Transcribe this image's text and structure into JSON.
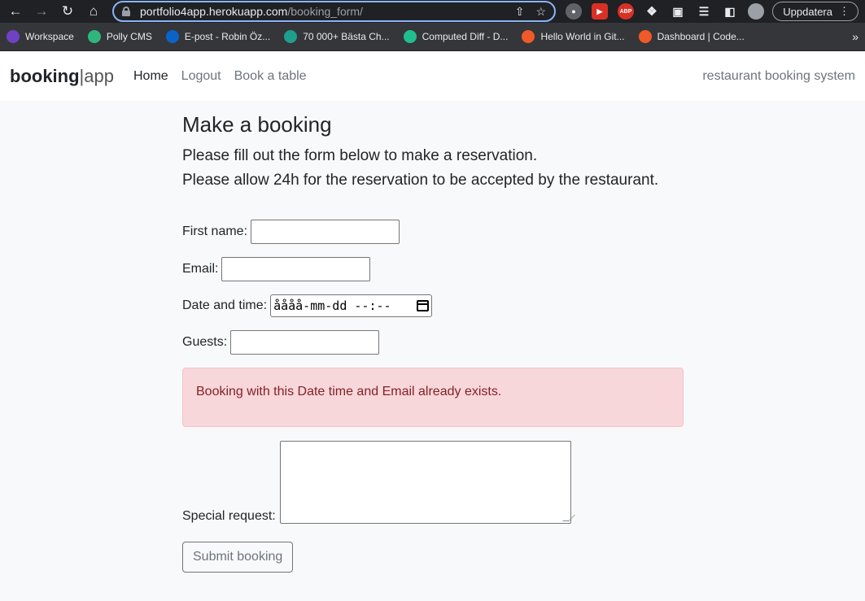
{
  "browser": {
    "url_host": "portfolio4app.herokuapp.com",
    "url_path": "/booking_form/",
    "update_label": "Uppdatera",
    "abp_label": "ABP",
    "bookmarks": [
      {
        "label": "Workspace",
        "icon": "workspace-icon",
        "color": "#6f42c1"
      },
      {
        "label": "Polly CMS",
        "icon": "polly-icon",
        "color": "#2fb67c"
      },
      {
        "label": "E-post - Robin Öz...",
        "icon": "outlook-icon",
        "color": "#0a64c8"
      },
      {
        "label": "70 000+ Bästa Ch...",
        "icon": "docs-icon",
        "color": "#1e9e8c"
      },
      {
        "label": "Computed Diff - D...",
        "icon": "diff-icon",
        "color": "#1fbf8f"
      },
      {
        "label": "Hello World in Git...",
        "icon": "git-icon",
        "color": "#f05a28"
      },
      {
        "label": "Dashboard | Code...",
        "icon": "dashboard-icon",
        "color": "#f05a28"
      }
    ]
  },
  "navbar": {
    "brand_bold": "booking",
    "brand_sep": "|",
    "brand_light": "app",
    "home": "Home",
    "logout": "Logout",
    "book": "Book a table",
    "right": "restaurant booking system"
  },
  "page": {
    "title": "Make a booking",
    "lead1": "Please fill out the form below to make a reservation.",
    "lead2": "Please allow 24h for the reservation to be accepted by the restaurant."
  },
  "form": {
    "first_name_label": "First name:",
    "first_name_value": "",
    "email_label": "Email:",
    "email_value": "",
    "datetime_label": "Date and time:",
    "datetime_value": "åååå-mm-dd --:--",
    "guests_label": "Guests:",
    "guests_value": "",
    "error": "Booking with this Date time and Email already exists.",
    "special_label": "Special request:",
    "submit_label": "Submit booking"
  }
}
